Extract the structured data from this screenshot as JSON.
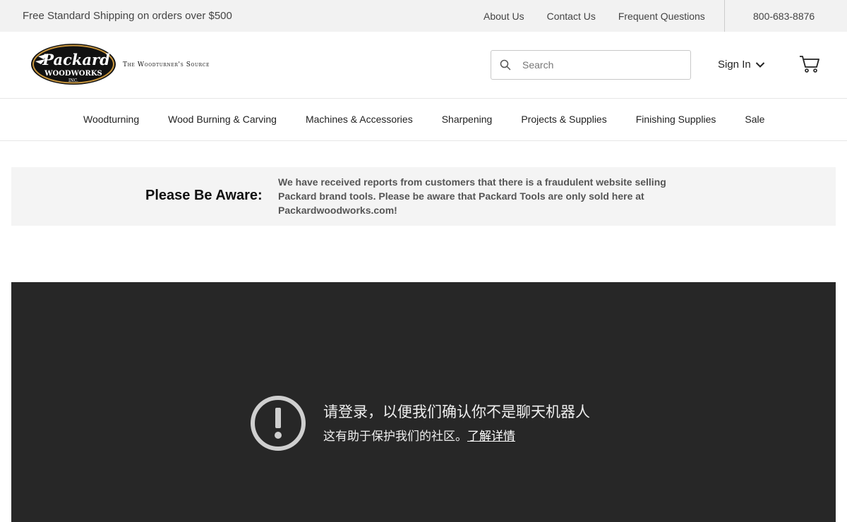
{
  "topbar": {
    "promo": "Free Standard Shipping on orders over $500",
    "links": [
      "About Us",
      "Contact Us",
      "Frequent Questions"
    ],
    "phone": "800-683-8876"
  },
  "header": {
    "logo": {
      "name": "Packard",
      "sub": "WOODWORKS",
      "inc": "INC."
    },
    "tagline": "The Woodturner's Source",
    "search": {
      "placeholder": "Search",
      "value": "",
      "icon": "search-icon"
    },
    "signin_label": "Sign In",
    "cart_icon": "cart-icon"
  },
  "nav": {
    "items": [
      "Woodturning",
      "Wood Burning & Carving",
      "Machines & Accessories",
      "Sharpening",
      "Projects & Supplies",
      "Finishing Supplies",
      "Sale"
    ]
  },
  "notice": {
    "title": "Please Be Aware:",
    "message": "We have received reports from customers that there is a fraudulent website selling Packard brand tools. Please be aware that Packard Tools are only sold here at Packardwoodworks.com!"
  },
  "embed": {
    "icon": "alert-icon",
    "heading": "请登录，以便我们确认你不是聊天机器人",
    "sub_text": "这有助于保护我们的社区。",
    "learn_more": "了解详情",
    "colors": {
      "background": "#272727",
      "text": "#eeeeee"
    }
  }
}
